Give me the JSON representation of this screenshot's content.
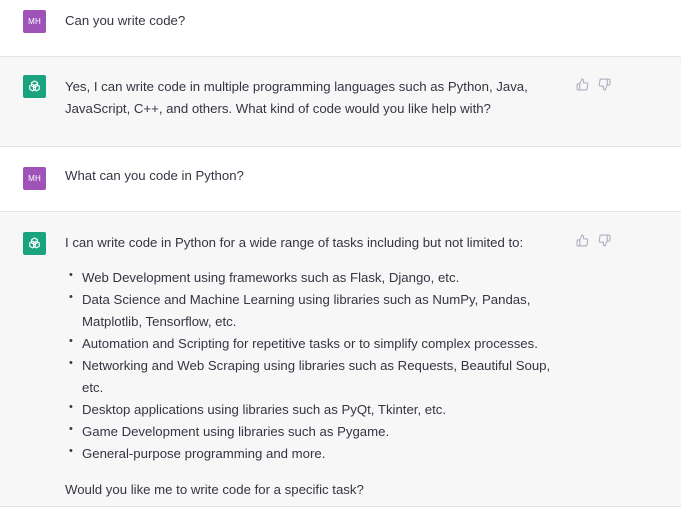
{
  "conversation": {
    "messages": [
      {
        "role": "user",
        "avatar_initials": "MH",
        "text": "Can you write code?"
      },
      {
        "role": "assistant",
        "avatar_icon": "openai-logo-icon",
        "text": "Yes, I can write code in multiple programming languages such as Python, Java, JavaScript, C++, and others. What kind of code would you like help with?",
        "feedback_icons": [
          "thumbs-up-icon",
          "thumbs-down-icon"
        ]
      },
      {
        "role": "user",
        "avatar_initials": "MH",
        "text": "What can you code in Python?"
      },
      {
        "role": "assistant",
        "avatar_icon": "openai-logo-icon",
        "intro": "I can write code in Python for a wide range of tasks including but not limited to:",
        "bullets": [
          "Web Development using frameworks such as Flask, Django, etc.",
          "Data Science and Machine Learning using libraries such as NumPy, Pandas, Matplotlib, Tensorflow, etc.",
          "Automation and Scripting for repetitive tasks or to simplify complex processes.",
          "Networking and Web Scraping using libraries such as Requests, Beautiful Soup, etc.",
          "Desktop applications using libraries such as PyQt, Tkinter, etc.",
          "Game Development using libraries such as Pygame.",
          "General-purpose programming and more."
        ],
        "outro": "Would you like me to write code for a specific task?",
        "feedback_icons": [
          "thumbs-up-icon",
          "thumbs-down-icon"
        ]
      }
    ]
  },
  "colors": {
    "user_avatar": "#9f53b9",
    "bot_avatar": "#19a37f",
    "assistant_bg": "#f7f7f8",
    "text": "#343541",
    "icon": "#acacbe"
  }
}
